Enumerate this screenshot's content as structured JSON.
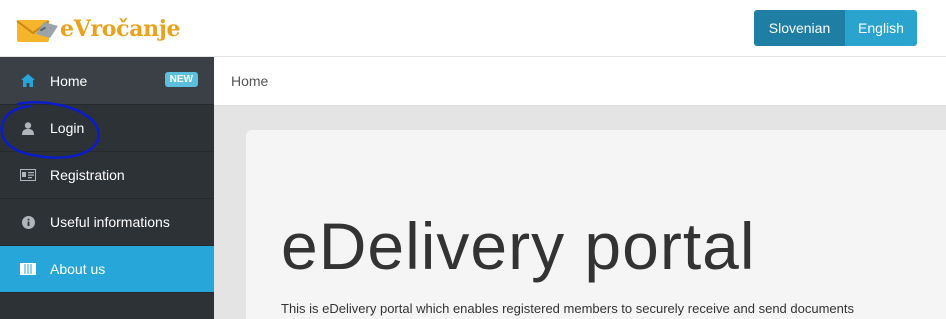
{
  "header": {
    "logo_text": "eVročanje",
    "languages": [
      {
        "label": "Slovenian"
      },
      {
        "label": "English"
      }
    ]
  },
  "sidebar": {
    "items": [
      {
        "label": "Home",
        "icon": "home-icon",
        "badge": "NEW"
      },
      {
        "label": "Login",
        "icon": "user-icon"
      },
      {
        "label": "Registration",
        "icon": "id-card-icon"
      },
      {
        "label": "Useful informations",
        "icon": "info-icon"
      },
      {
        "label": "About us",
        "icon": "columns-icon",
        "active": true
      }
    ]
  },
  "breadcrumb": {
    "current": "Home"
  },
  "main": {
    "title": "eDelivery portal",
    "intro": "This is eDelivery portal which enables registered members to securely receive and send documents"
  },
  "colors": {
    "accent": "#27a6d9",
    "sidebar_bg": "#2d3237",
    "logo": "#e8a21b",
    "lang_active": "#1f7ea3",
    "annotation": "#0a1ccc"
  }
}
